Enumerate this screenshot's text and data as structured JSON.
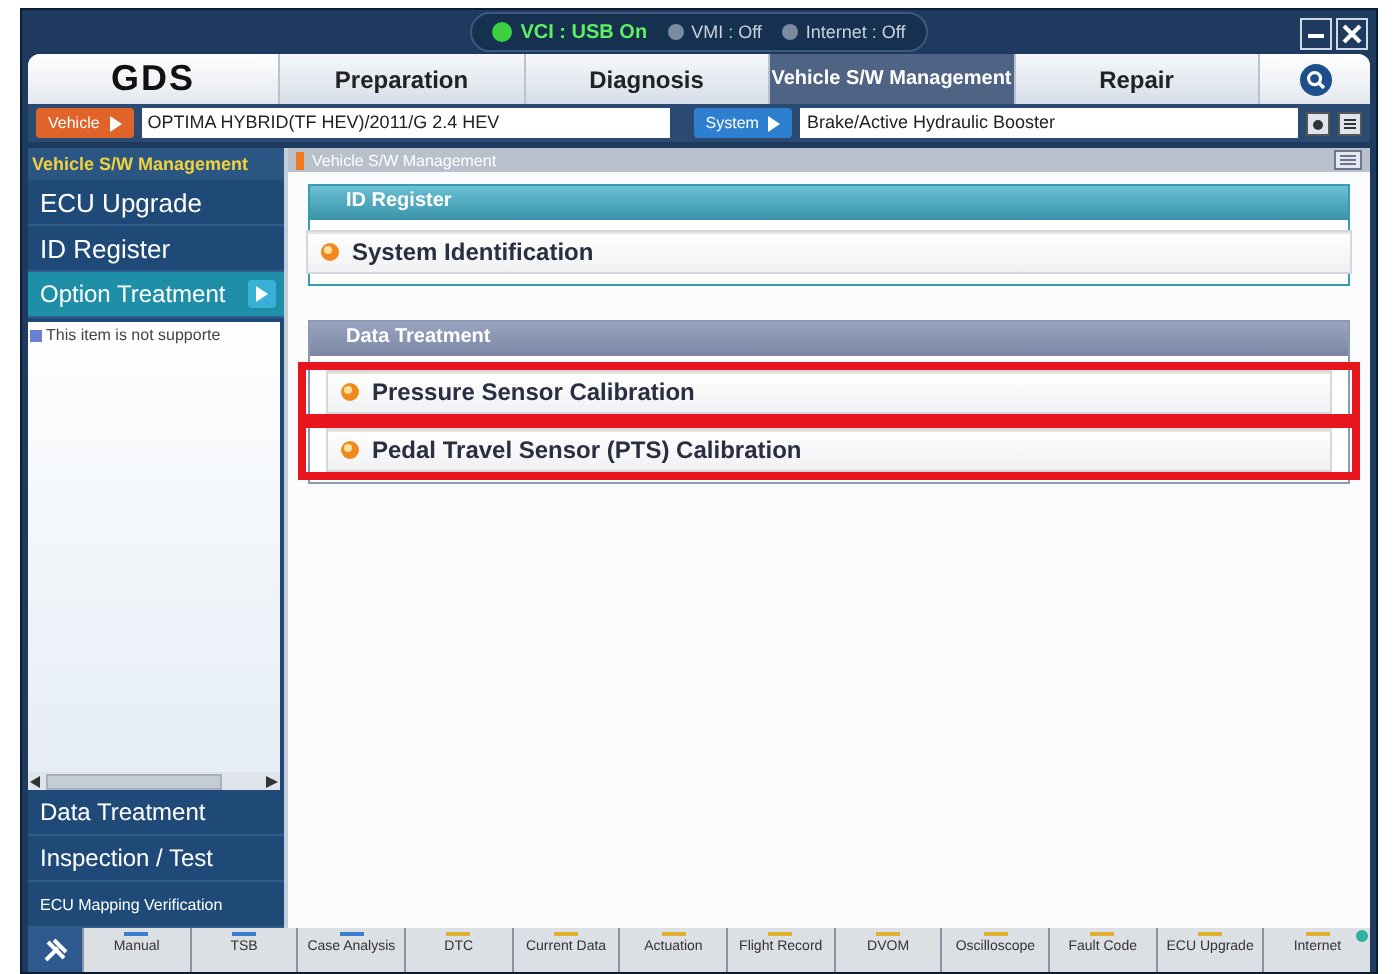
{
  "status": [
    {
      "label": "VCI : USB On",
      "on": true
    },
    {
      "label": "VMI : Off",
      "on": false
    },
    {
      "label": "Internet : Off",
      "on": false
    }
  ],
  "logo": "GDS",
  "tabs": [
    {
      "label": "Preparation",
      "selected": false
    },
    {
      "label": "Diagnosis",
      "selected": false
    },
    {
      "label": "Vehicle S/W Management",
      "selected": true
    },
    {
      "label": "Repair",
      "selected": false
    }
  ],
  "vehicle": {
    "button": "Vehicle",
    "value": "OPTIMA HYBRID(TF HEV)/2011/G 2.4 HEV"
  },
  "system": {
    "button": "System",
    "value": "Brake/Active Hydraulic Booster"
  },
  "sidebar": {
    "title": "Vehicle S/W Management",
    "items": [
      {
        "label": "ECU Upgrade",
        "selected": false
      },
      {
        "label": "ID Register",
        "selected": false
      },
      {
        "label": "Option Treatment",
        "selected": true
      }
    ],
    "note": "This item is not supporte",
    "bottom_items": [
      {
        "label": "Data Treatment"
      },
      {
        "label": "Inspection / Test"
      },
      {
        "label": "ECU Mapping Verification"
      }
    ]
  },
  "breadcrumb": "Vehicle S/W Management",
  "sections": [
    {
      "title": "ID Register",
      "kind": "id",
      "items": [
        {
          "label": "System Identification",
          "highlighted": false
        }
      ]
    },
    {
      "title": "Data Treatment",
      "kind": "data",
      "items": [
        {
          "label": "Pressure Sensor Calibration",
          "highlighted": true
        },
        {
          "label": "Pedal Travel Sensor (PTS) Calibration",
          "highlighted": true
        }
      ]
    }
  ],
  "toolbar": [
    {
      "label": "Manual",
      "color": "#3a7fd0"
    },
    {
      "label": "TSB",
      "color": "#3a7fd0"
    },
    {
      "label": "Case Analysis",
      "color": "#3a7fd0"
    },
    {
      "label": "DTC",
      "color": "#e0b030"
    },
    {
      "label": "Current Data",
      "color": "#e0b030"
    },
    {
      "label": "Actuation",
      "color": "#e0b030"
    },
    {
      "label": "Flight Record",
      "color": "#e0b030"
    },
    {
      "label": "DVOM",
      "color": "#e0b030"
    },
    {
      "label": "Oscilloscope",
      "color": "#e0b030"
    },
    {
      "label": "Fault Code",
      "color": "#e0b030"
    },
    {
      "label": "ECU Upgrade",
      "color": "#e0b030"
    },
    {
      "label": "Internet",
      "color": "#e0b030"
    }
  ]
}
